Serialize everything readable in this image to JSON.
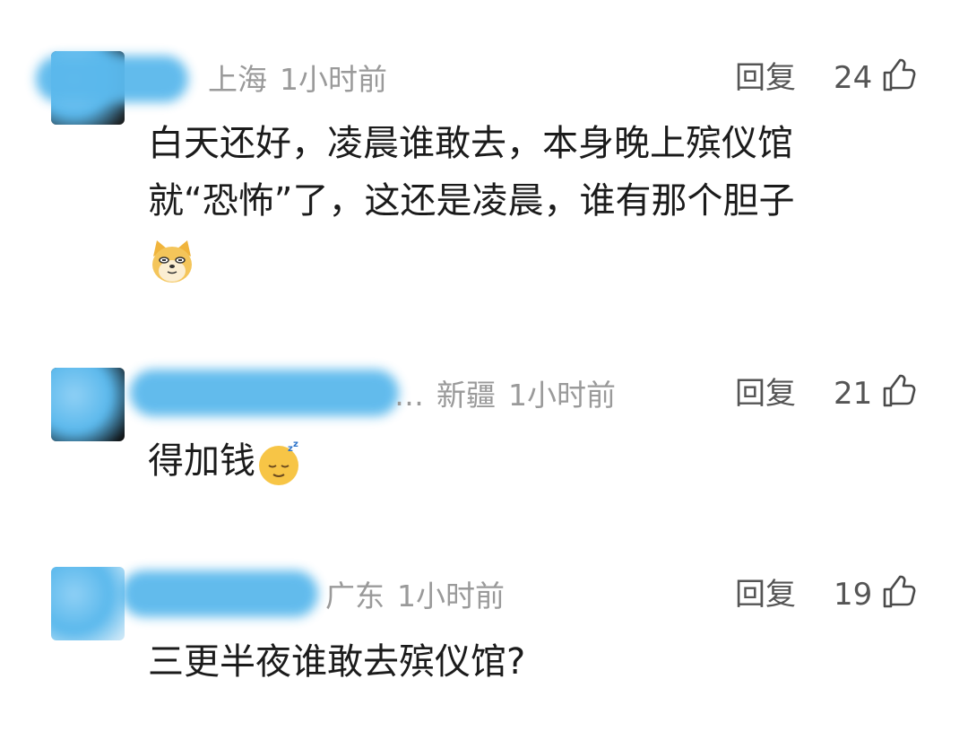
{
  "comments": [
    {
      "location": "上海",
      "time": "1小时前",
      "reply_label": "回复",
      "likes": "24",
      "content_lines": [
        "白天还好，凌晨谁敢去，本身晚上殡仪馆",
        "就“恐怖”了，这还是凌晨，谁有那个胆子"
      ],
      "emoji": "doge-emoji"
    },
    {
      "ellipsis": "…",
      "location": "新疆",
      "time": "1小时前",
      "reply_label": "回复",
      "likes": "21",
      "content": "得加钱",
      "emoji": "sleeping-face-emoji"
    },
    {
      "location": "广东",
      "time": "1小时前",
      "reply_label": "回复",
      "likes": "19",
      "content": "三更半夜谁敢去殡仪馆?"
    }
  ],
  "colors": {
    "blur": "#5ab8ec",
    "meta": "#9a9a9a",
    "text": "#1b1b1b"
  }
}
